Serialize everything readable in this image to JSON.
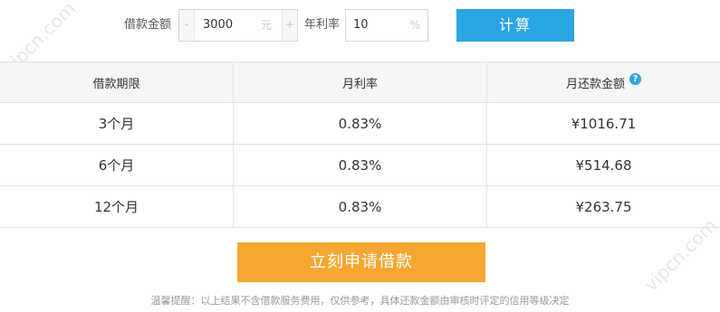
{
  "form": {
    "amount_label": "借款金额",
    "amount_minus": "-",
    "amount_value": "3000",
    "amount_unit": "元",
    "amount_plus": "+",
    "rate_label": "年利率",
    "rate_value": "10",
    "rate_unit": "%",
    "calc_button": "计算"
  },
  "table": {
    "headers": [
      "借款期限",
      "月利率",
      "月还款金额"
    ],
    "help_icon": "?",
    "rows": [
      [
        "3个月",
        "0.83%",
        "¥1016.71"
      ],
      [
        "6个月",
        "0.83%",
        "¥514.68"
      ],
      [
        "12个月",
        "0.83%",
        "¥263.75"
      ]
    ]
  },
  "apply_button": "立刻申请借款",
  "notice": "温馨提醒：以上结果不含借款服务费用，仅供参考，具体还款金额由审核时评定的信用等级决定",
  "watermark": "vipcn.com",
  "colors": {
    "calc_button": "#2aa5e3",
    "apply_button": "#f5a732",
    "header_bg": "#f6f6f6"
  }
}
